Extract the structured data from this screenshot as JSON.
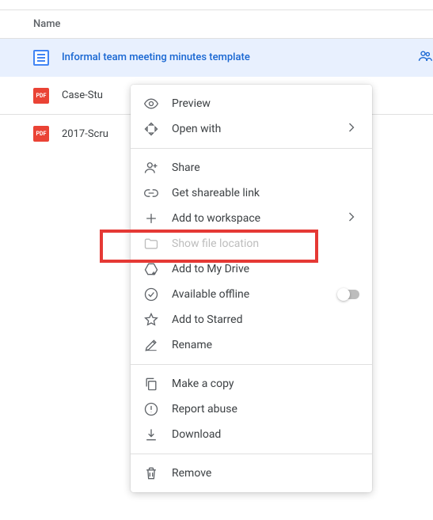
{
  "header": {
    "name_col": "Name"
  },
  "files": [
    {
      "name": "Informal team meeting minutes template",
      "type": "doc",
      "selected": true,
      "shared": true
    },
    {
      "name": "Case-Stu",
      "type": "pdf",
      "selected": false,
      "shared": false
    },
    {
      "name": "2017-Scru",
      "type": "pdf",
      "selected": false,
      "shared": false
    }
  ],
  "menu": {
    "preview": "Preview",
    "open_with": "Open with",
    "share": "Share",
    "get_link": "Get shareable link",
    "add_workspace": "Add to workspace",
    "show_location": "Show file location",
    "add_drive": "Add to My Drive",
    "offline": "Available offline",
    "starred": "Add to Starred",
    "rename": "Rename",
    "copy": "Make a copy",
    "report": "Report abuse",
    "download": "Download",
    "remove": "Remove"
  },
  "pdf_label": "PDF"
}
